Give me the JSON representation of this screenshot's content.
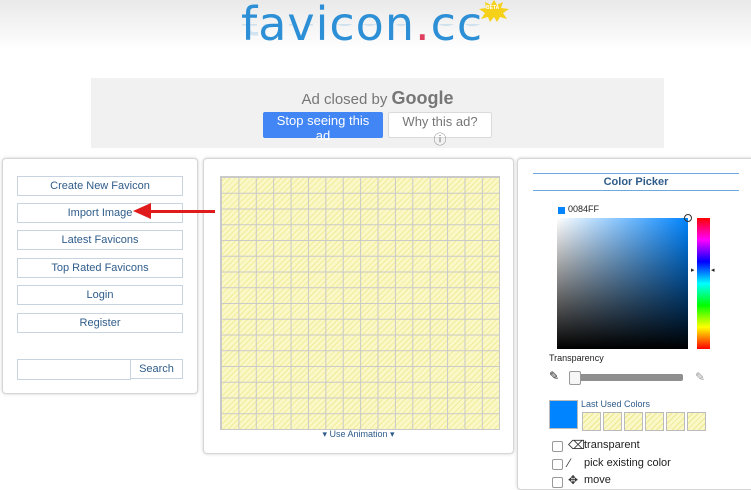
{
  "logo": {
    "text_main": "favicon",
    "text_dot": ".",
    "text_tld": "cc",
    "badge": "BETA"
  },
  "ad": {
    "closed_text": "Ad closed by",
    "closed_brand": "Google",
    "stop_button": "Stop seeing this ad",
    "why_button": "Why this ad?",
    "why_icon": "info-icon"
  },
  "sidebar": {
    "items": [
      {
        "label": "Create New Favicon"
      },
      {
        "label": "Import Image"
      },
      {
        "label": "Latest Favicons"
      },
      {
        "label": "Top Rated Favicons"
      },
      {
        "label": "Login"
      },
      {
        "label": "Register"
      }
    ],
    "search": {
      "placeholder": "",
      "button": "Search"
    }
  },
  "editor": {
    "grid": {
      "rows": 16,
      "cols": 16
    },
    "use_animation": "▾ Use Animation ▾"
  },
  "color_picker": {
    "title": "Color Picker",
    "hex": "0084FF",
    "current_color": "#0084FF",
    "transparency_label": "Transparency",
    "transparency_value": 0,
    "last_used_label": "Last Used Colors",
    "last_used_count": 6,
    "options": [
      {
        "label": "transparent",
        "icon": "eraser-icon"
      },
      {
        "label": "pick existing color",
        "icon": "eyedropper-icon"
      },
      {
        "label": "move",
        "icon": "move-icon"
      }
    ]
  },
  "colors": {
    "brand_blue": "#2d8fd6",
    "brand_pink": "#e04060",
    "arrow_red": "#e01b1b",
    "grid_yellow": "#fbf8c8"
  }
}
